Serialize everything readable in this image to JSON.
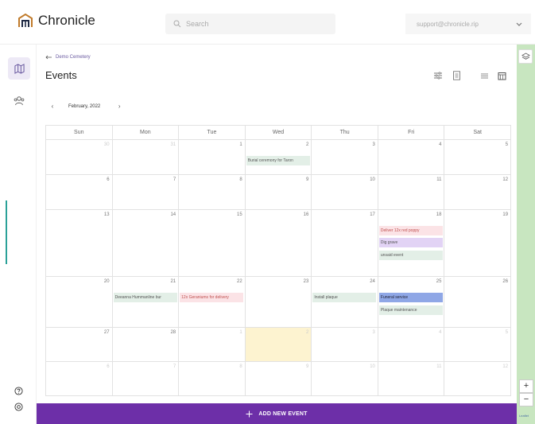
{
  "app": {
    "name": "Chronicle"
  },
  "search": {
    "placeholder": "Search"
  },
  "user": {
    "email": "support@chronicle.rip"
  },
  "breadcrumb": {
    "label": "Demo Cemetery"
  },
  "page": {
    "title": "Events"
  },
  "calendar": {
    "month_label": "February, 2022",
    "weekdays": [
      "Sun",
      "Mon",
      "Tue",
      "Wed",
      "Thu",
      "Fri",
      "Sat"
    ],
    "weeks": [
      [
        "30",
        "31",
        "1",
        "2",
        "3",
        "4",
        "5"
      ],
      [
        "6",
        "7",
        "8",
        "9",
        "10",
        "11",
        "12"
      ],
      [
        "13",
        "14",
        "15",
        "16",
        "17",
        "18",
        "19"
      ],
      [
        "20",
        "21",
        "22",
        "23",
        "24",
        "25",
        "26"
      ],
      [
        "27",
        "28",
        "1",
        "2",
        "3",
        "4",
        "5"
      ],
      [
        "6",
        "7",
        "8",
        "9",
        "10",
        "11",
        "12"
      ]
    ],
    "events": {
      "burial": "Burial ceremony for Taron",
      "deliver": "Deliver 12x red poppy",
      "dig": "Dig grave",
      "unsaid": "unsaid event",
      "deeanna": "Deeanna Hummanline bur",
      "geraniums": "12x Geraniums for delivery",
      "install": "Install plaque",
      "funeral": "Funeral service",
      "plaque": "Plaque maintenance"
    }
  },
  "actions": {
    "add_event": "ADD NEW EVENT"
  },
  "map": {
    "attribution": "Leaflet"
  },
  "colors": {
    "accent": "#6d2fa8",
    "today": "#fdf3d0"
  }
}
